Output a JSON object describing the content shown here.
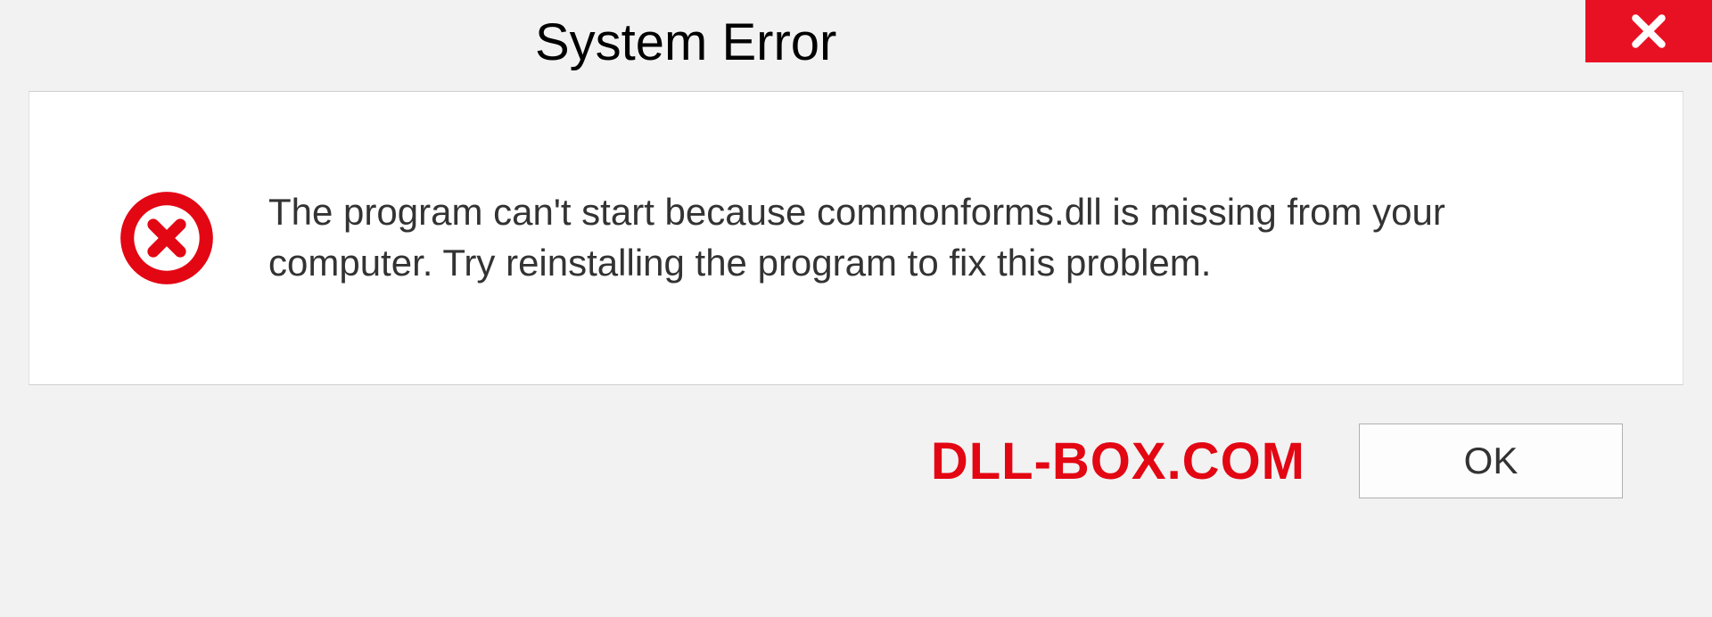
{
  "titlebar": {
    "title": "System Error"
  },
  "content": {
    "message": "The program can't start because commonforms.dll is missing from your computer. Try reinstalling the program to fix this problem."
  },
  "footer": {
    "watermark": "DLL-BOX.COM",
    "ok_label": "OK"
  }
}
